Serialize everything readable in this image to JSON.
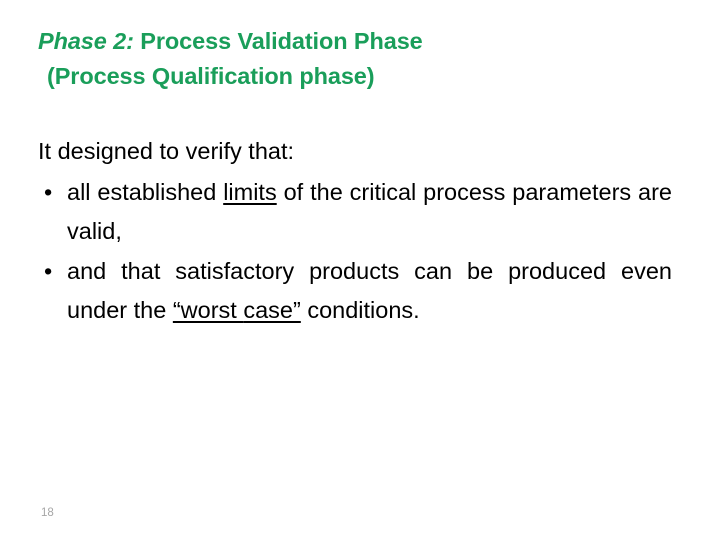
{
  "slide": {
    "background_color": "#ffffff",
    "accent_color": "#1a9e5a",
    "body_text_color": "#000000",
    "page_number_color": "#a6a6a6"
  },
  "title": {
    "line1_emphasis": "Phase 2:",
    "line1_rest": " Process Validation Phase",
    "line2": "(Process Qualification phase)"
  },
  "body": {
    "intro": "It designed to verify that:",
    "bullets": [
      {
        "marker": "•",
        "segments": [
          {
            "text": "all established ",
            "underline": false
          },
          {
            "text": "limits",
            "underline": true
          },
          {
            "text": " of the critical process parameters are valid,",
            "underline": false
          }
        ],
        "plain": "all established limits of the critical process parameters are valid,"
      },
      {
        "marker": "•",
        "segments": [
          {
            "text": "and that satisfactory products can be produced even under the ",
            "underline": false
          },
          {
            "text": "“worst ",
            "underline": true
          },
          {
            "text": " ",
            "underline": false
          },
          {
            "text": "case”",
            "underline": true
          },
          {
            "text": " conditions.",
            "underline": false
          }
        ],
        "plain": "and that satisfactory products can be produced even under the “worst case” conditions."
      }
    ]
  },
  "footer": {
    "page_number": "18"
  }
}
